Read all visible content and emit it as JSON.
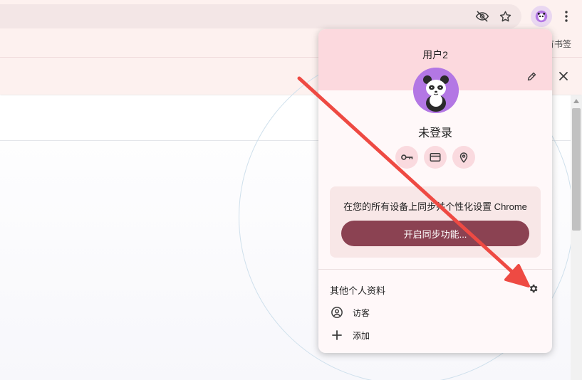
{
  "browser": {
    "bookmarks_bar_text": "有书签",
    "icons": {
      "hide_eye": "eye-off-icon",
      "star": "star-icon",
      "profile": "profile-avatar-icon",
      "menu": "kebab-menu-icon",
      "close": "close-icon"
    }
  },
  "profile_menu": {
    "title": "用户2",
    "status": "未登录",
    "quick_actions": [
      "key-icon",
      "credit-card-icon",
      "location-pin-icon"
    ],
    "sync": {
      "description": "在您的所有设备上同步并个性化设置 Chrome",
      "button_label": "开启同步功能..."
    },
    "other_profiles_label": "其他个人资料",
    "items": [
      {
        "label": "访客",
        "icon": "guest-account-icon"
      },
      {
        "label": "添加",
        "icon": "plus-icon"
      }
    ]
  },
  "colors": {
    "header_pink": "#fcd9de",
    "avatar_purple": "#b377e4",
    "sync_button": "#8b4252",
    "annotation_red": "#ee4a43"
  }
}
